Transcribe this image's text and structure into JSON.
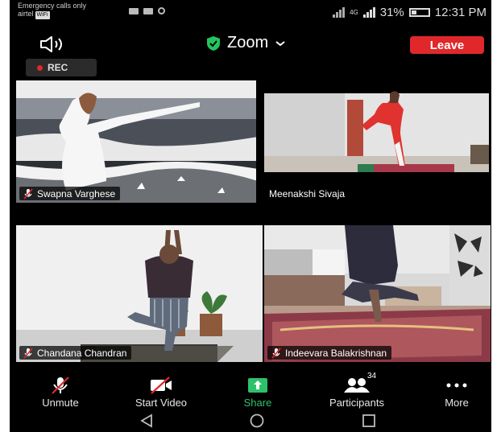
{
  "status_bar": {
    "notice": "Emergency calls only",
    "carrier": "airtel",
    "carrier_tag": "WiFi",
    "network": "4G",
    "battery_percent": "31%",
    "battery_level": 0.31,
    "time": "12:31 PM"
  },
  "header": {
    "title": "Zoom",
    "leave_label": "Leave",
    "speaker_icon": "speaker-icon",
    "shield_icon": "shield-check-icon",
    "colors": {
      "leave": "#e0282b",
      "shield": "#23c55e"
    }
  },
  "recording": {
    "label": "REC"
  },
  "participants": [
    {
      "name": "Swapna Varghese",
      "muted": true,
      "active": false
    },
    {
      "name": "Meenakshi Sivaja",
      "muted": false,
      "active": true
    },
    {
      "name": "Chandana Chandran",
      "muted": true,
      "active": false
    },
    {
      "name": "Indeevara Balakrishnan",
      "muted": true,
      "active": false
    }
  ],
  "toolbar": {
    "unmute": "Unmute",
    "start_video": "Start Video",
    "share": "Share",
    "participants": "Participants",
    "participants_count": "34",
    "more": "More",
    "share_color": "#2ec16b"
  },
  "nav_icons": [
    "back-icon",
    "home-icon",
    "recents-icon"
  ]
}
